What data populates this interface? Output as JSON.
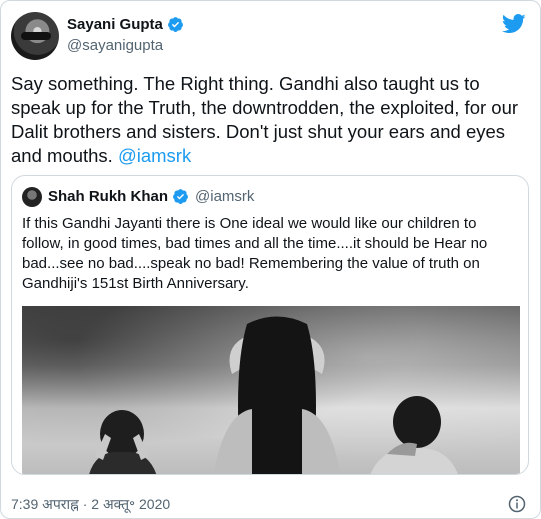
{
  "author": {
    "display_name": "Sayani Gupta",
    "handle": "@sayanigupta",
    "verified": true
  },
  "tweet": {
    "text": "Say something. The Right thing. Gandhi also taught us to speak up for the Truth, the downtrodden, the exploited, for our Dalit brothers and sisters. Don't just shut your ears and eyes and mouths. ",
    "mention": "@iamsrk"
  },
  "quoted_tweet": {
    "display_name": "Shah Rukh Khan",
    "handle": "@iamsrk",
    "verified": true,
    "text": "If this Gandhi Jayanti there is One ideal we would like our children to follow, in good times, bad times and all the time....it should be Hear no bad...see no bad....speak no bad!  Remembering the value of truth on Gandhiji's 151st Birth Anniversary."
  },
  "timestamp": "7:39 अपराह्न · 2 अक्तू॰ 2020",
  "icons": {
    "brand": "twitter-bird-icon",
    "verified": "verified-badge-icon",
    "info": "info-icon"
  },
  "colors": {
    "accent": "#1d9bf0",
    "text": "#0f1419",
    "secondary_text": "#536471",
    "border": "#cfd9de"
  }
}
